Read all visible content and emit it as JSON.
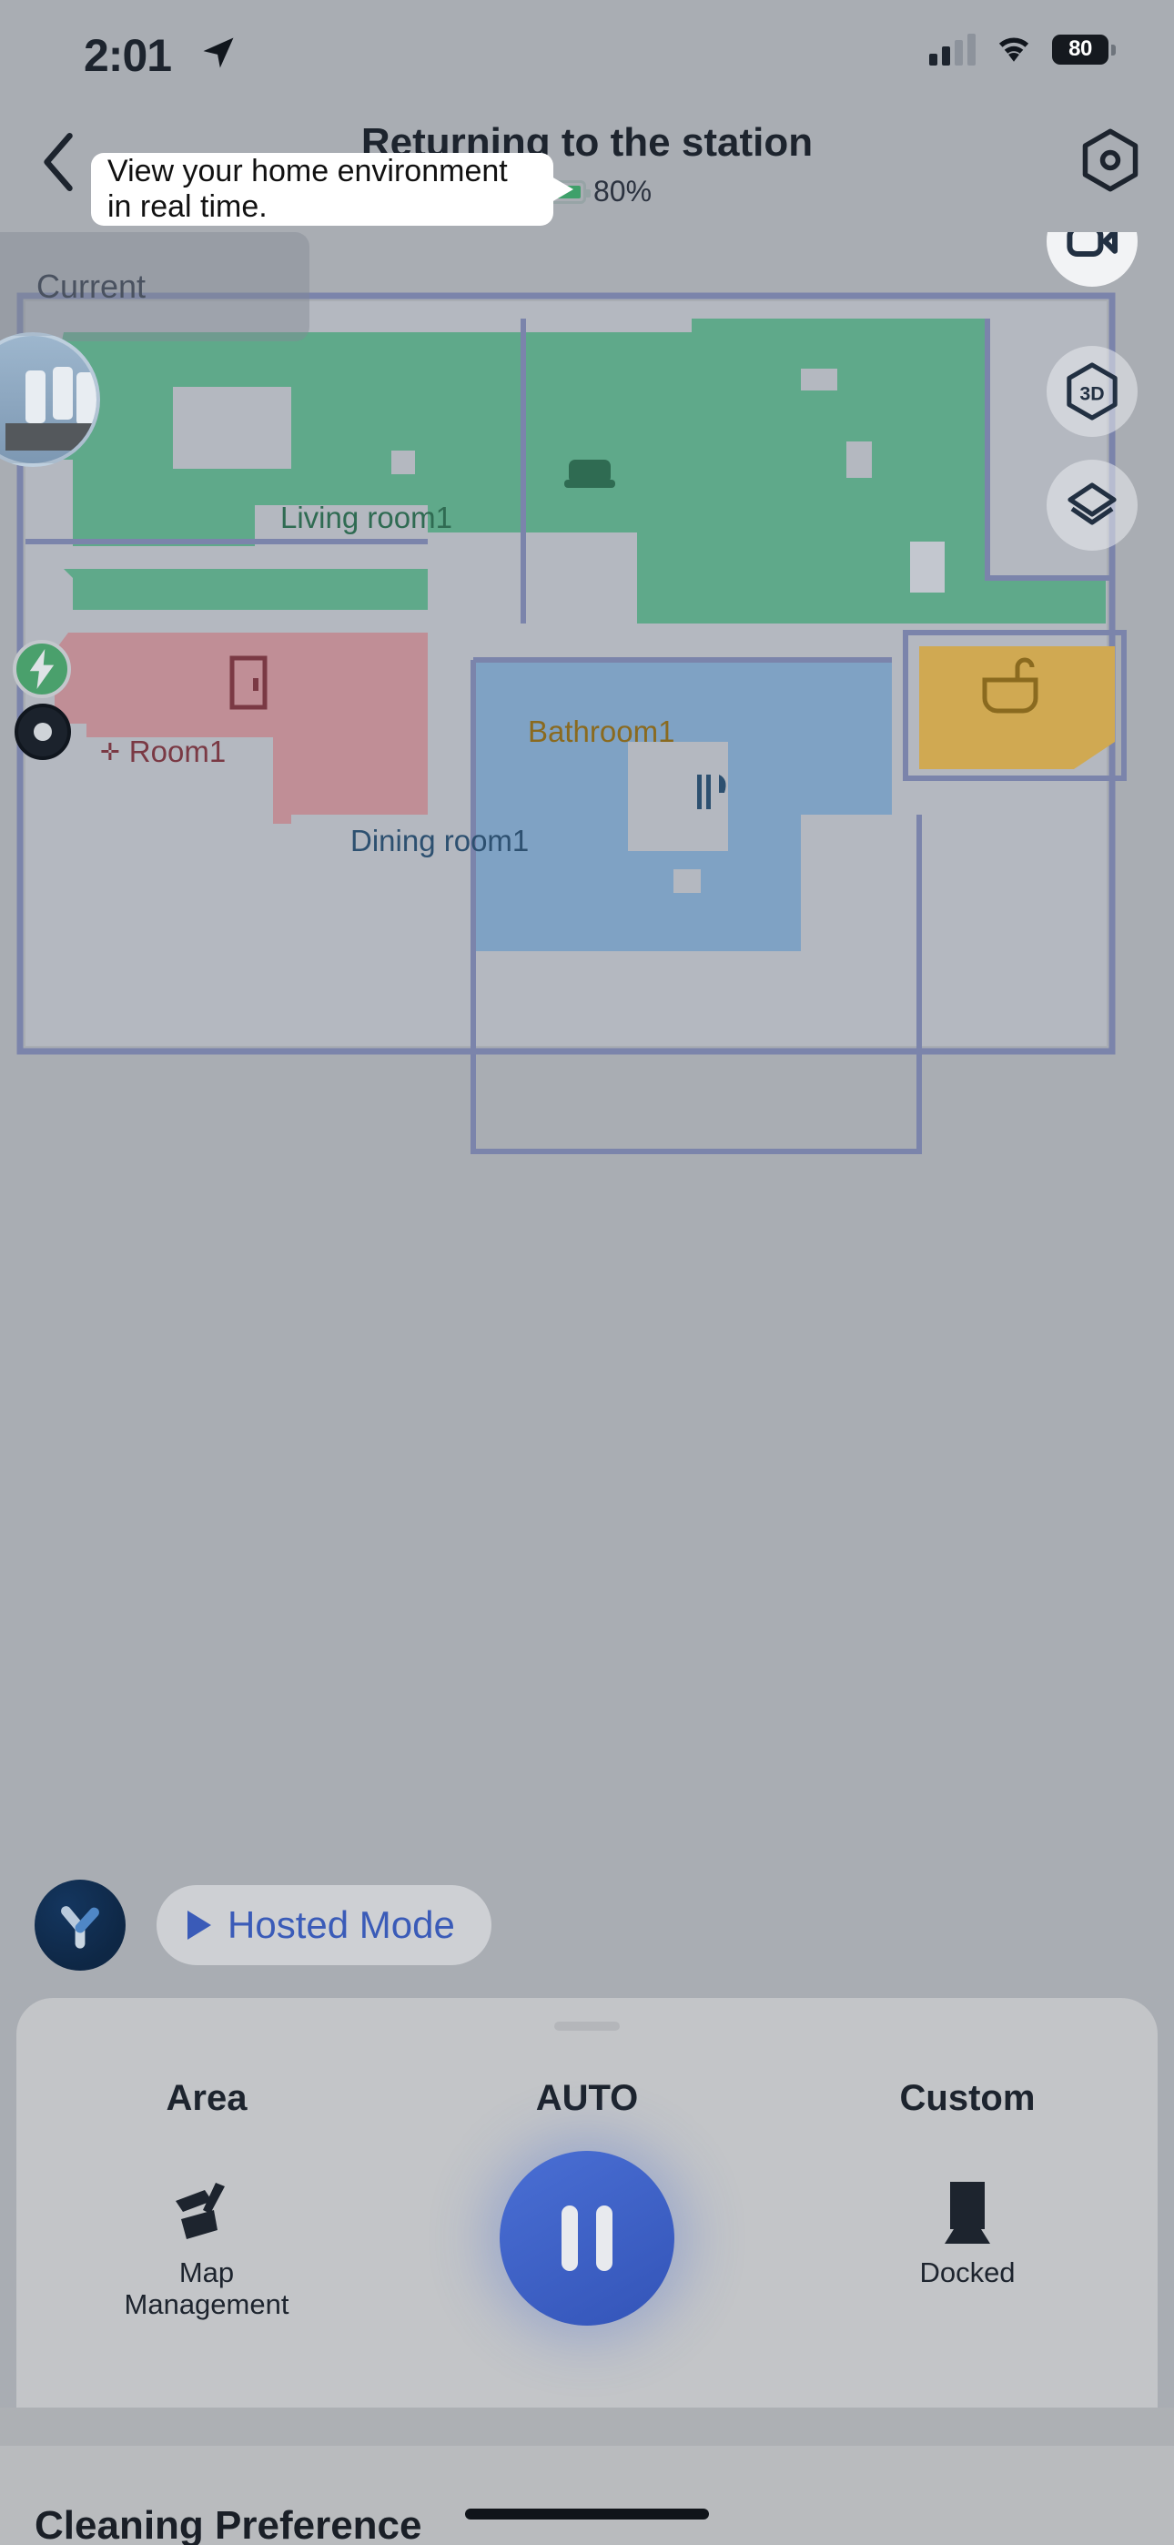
{
  "status_bar": {
    "time": "2:01",
    "location_icon": "location-arrow-icon",
    "signal_icon": "cellular-signal-icon",
    "wifi_icon": "wifi-icon",
    "battery_level": "80"
  },
  "nav": {
    "back_icon": "chevron-left-icon",
    "title": "Returning to the station",
    "battery_percent": "80%",
    "charging_icon": "lightning-bolt-icon",
    "settings_icon": "hexagon-settings-icon"
  },
  "map": {
    "current_chip_label": "Current",
    "thumbnail_name": "camera-snapshot-thumbnail",
    "buttons": [
      {
        "name": "camera-button",
        "icon": "video-camera-icon"
      },
      {
        "name": "view-3d-button",
        "icon": "3d-hexagon-icon",
        "label": "3D"
      },
      {
        "name": "map-layers-button",
        "icon": "layers-icon"
      }
    ],
    "rooms": [
      {
        "name": "Living room1",
        "color": "#5fa98a",
        "icon": "sofa-icon"
      },
      {
        "name": "Room1",
        "color": "#c08e96",
        "icon": "door-icon"
      },
      {
        "name": "Dining room1",
        "color": "#7fa2c4",
        "icon": "cutlery-icon"
      },
      {
        "name": "Bathroom1",
        "color": "#d0a952",
        "icon": "bathtub-icon"
      }
    ],
    "robot_icon": "robot-vacuum-icon",
    "charging_badge_icon": "charging-bolt-icon"
  },
  "tooltip": {
    "text": "View your home environment in real time."
  },
  "hosted": {
    "brand_icon": "y-brand-logo-icon",
    "play_icon": "play-triangle-icon",
    "label": "Hosted Mode"
  },
  "sheet": {
    "grabber": "sheet-grabber",
    "columns": [
      {
        "head": "Area",
        "icon": "map-management-icon",
        "caption_line1": "Map",
        "caption_line2": "Management"
      },
      {
        "head": "AUTO",
        "icon": "pause-icon",
        "caption_line1": "",
        "caption_line2": ""
      },
      {
        "head": "Custom",
        "icon": "dock-station-icon",
        "caption_line1": "Docked",
        "caption_line2": ""
      }
    ]
  },
  "footer": {
    "title": "Cleaning Preference",
    "home_indicator": "home-indicator"
  },
  "colors": {
    "accent_blue": "#3354b8",
    "bg": "#a9adb3",
    "living_room": "#5fa98a",
    "room": "#c08e96",
    "dining_room": "#7fa2c4",
    "bathroom": "#d0a952",
    "wall": "#7b84ab",
    "unmapped": "#b4b8c0"
  }
}
